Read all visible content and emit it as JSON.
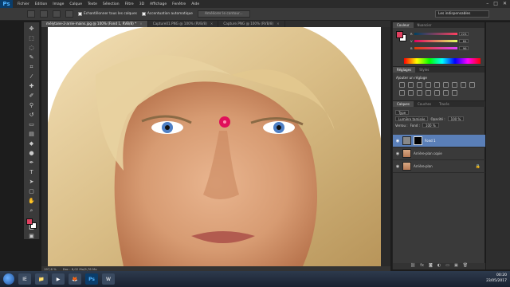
{
  "app": {
    "logo": "Ps",
    "accent": "#4fb3ff"
  },
  "menu": {
    "items": [
      "Fichier",
      "Edition",
      "Image",
      "Calque",
      "Texte",
      "Sélection",
      "Filtre",
      "3D",
      "Affichage",
      "Fenêtre",
      "Aide"
    ]
  },
  "window_controls": [
    "–",
    "□",
    "✕"
  ],
  "options": {
    "sample_all_layers": "Echantillonner tous les calques",
    "auto_enhance": "Accentuation automatique",
    "refine_edge": "Améliorer le contour..."
  },
  "workspace": "Les indispensables",
  "tabs": [
    {
      "label": "mélytane-2-arrie-mains.jpg @ 100% (Fond 1, RVB/8) *",
      "active": true
    },
    {
      "label": "Capture01.PNG @ 100% (RVB/8)",
      "active": false
    },
    {
      "label": "Capture.PNG @ 100% (RVB/8)",
      "active": false
    }
  ],
  "status": {
    "zoom": "197,6 %",
    "doc": "Doc : 6,02 Mo/9,76 Mo"
  },
  "color_panel": {
    "tabs": [
      "Couleur",
      "Nuancier"
    ],
    "fg": "#e04060",
    "bg": "#ffffff",
    "channels": [
      {
        "label": "R",
        "value": "224"
      },
      {
        "label": "V",
        "value": "64"
      },
      {
        "label": "B",
        "value": "96"
      }
    ]
  },
  "adjust_panel": {
    "tabs": [
      "Réglages",
      "Styles"
    ],
    "title": "Ajouter un réglage"
  },
  "layers_panel": {
    "tabs": [
      "Calques",
      "Couches",
      "Tracés"
    ],
    "kind": "Type",
    "blend_mode": "Lumière tamisée",
    "opacity_label": "Opacité :",
    "opacity_value": "100 %",
    "lock_label": "Verrou :",
    "fill_label": "Fond :",
    "fill_value": "100 %",
    "layers": [
      {
        "name": "Fond 1",
        "active": true
      },
      {
        "name": "Arrière-plan copie",
        "active": false
      },
      {
        "name": "Arrière-plan",
        "active": false
      }
    ]
  },
  "taskbar": {
    "apps": [
      "IE",
      "📁",
      "▶",
      "🦊",
      "Ps",
      "W"
    ],
    "time": "00:20",
    "date": "23/05/2017"
  }
}
